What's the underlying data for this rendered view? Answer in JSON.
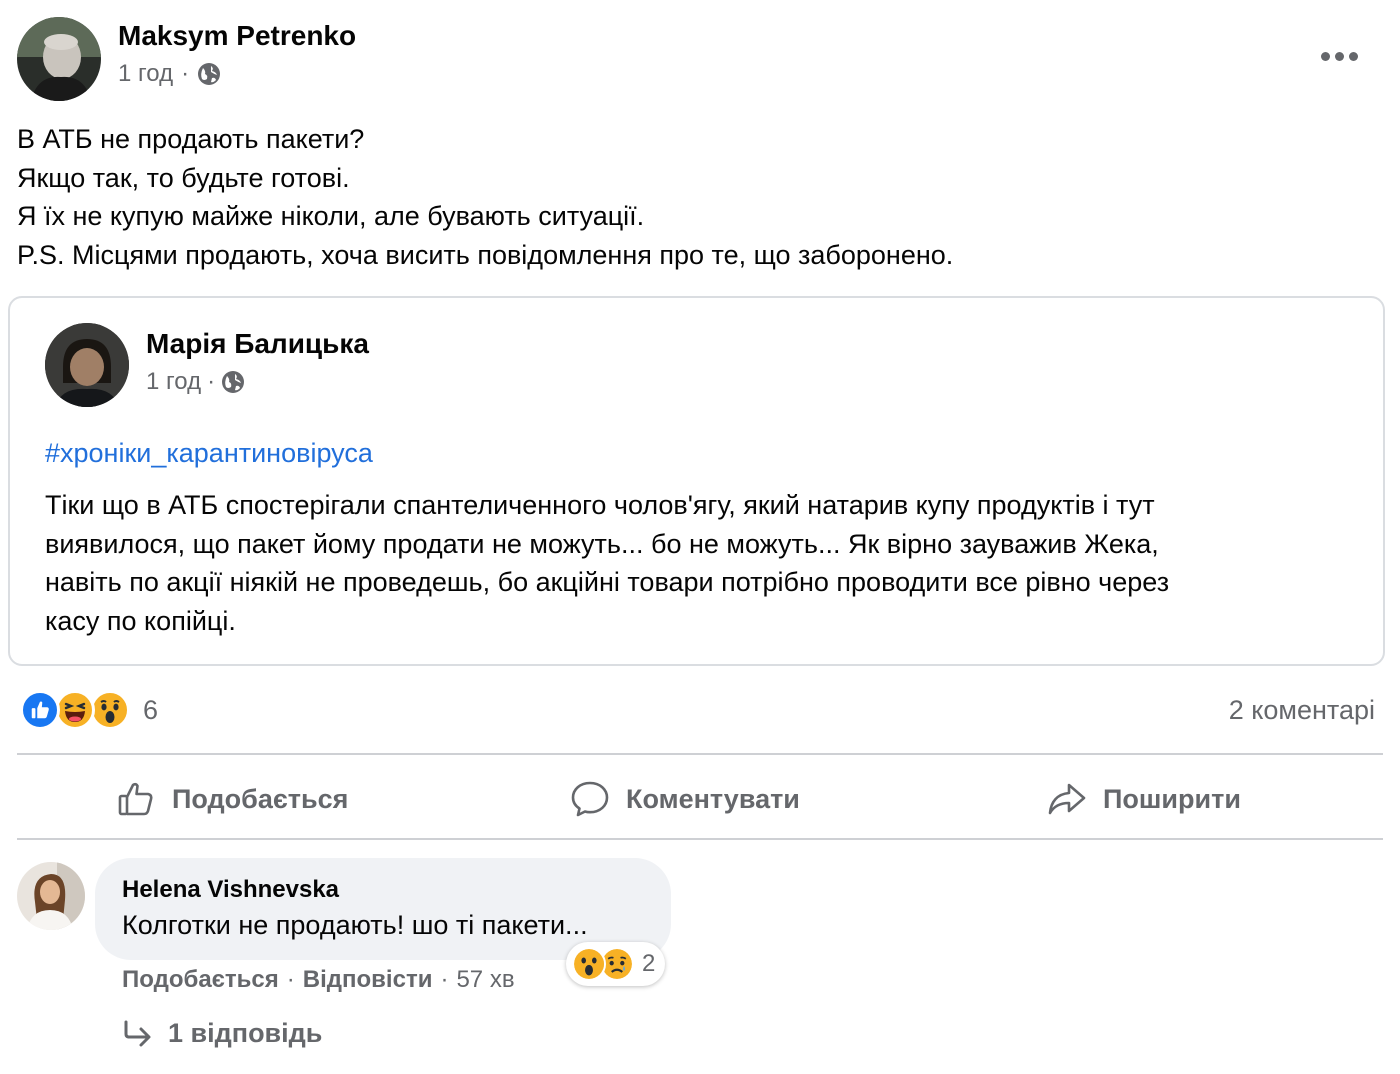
{
  "post": {
    "author": "Maksym Petrenko",
    "time": "1 год",
    "separator": "·",
    "privacy_icon": "globe-icon",
    "more_icon": "more-options-icon",
    "text_lines": [
      "В АТБ не продають пакети?",
      "Якщо так, то будьте готові.",
      "Я їх не купую майже ніколи, але бувають ситуації.",
      "P.S. Місцями продають, хоча висить повідомлення про те, що заборонено."
    ]
  },
  "shared": {
    "author": "Марія Балицька",
    "time": "1 год",
    "separator": "·",
    "hashtag": "#хроніки_карантиновіруса",
    "text_lines": [
      "Тіки що в АТБ спостерігали спантеличенного чолов'ягу, який натарив купу продуктів і тут",
      "виявилося, що пакет йому продати не можуть... бо не можуть... Як вірно зауважив Жека,",
      "навіть по акції ніякій не проведешь, бо акційні товари потрібно проводити все рівно через",
      "касу по копійці."
    ]
  },
  "reactions": {
    "icons": [
      "like-reaction-icon",
      "haha-reaction-icon",
      "wow-reaction-icon"
    ],
    "count": "6",
    "comments": "2 коментарі"
  },
  "actions": {
    "like": "Подобається",
    "comment": "Коментувати",
    "share": "Поширити"
  },
  "comment": {
    "author": "Helena Vishnevska",
    "text": "Колготки не продають! шо ті пакети...",
    "reactions_count": "2",
    "like": "Подобається",
    "reply": "Відповісти",
    "separator": "·",
    "time": "57 хв",
    "replies": "1 відповідь"
  },
  "colors": {
    "link": "#216fdb",
    "secondary_text": "#65676b",
    "like_blue": "#1877f2",
    "emoji_yellow": "#f7b125"
  }
}
